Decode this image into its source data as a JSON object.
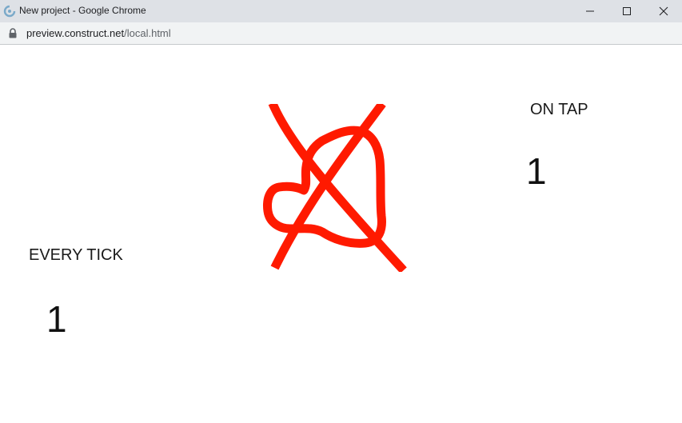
{
  "window": {
    "title": "New project - Google Chrome",
    "minimize_icon": "minimize-icon",
    "maximize_icon": "maximize-icon",
    "close_icon": "close-icon"
  },
  "address_bar": {
    "url_host": "preview.construct.net",
    "url_path": "/local.html",
    "lock_icon": "lock-icon"
  },
  "content": {
    "on_tap": {
      "label": "ON TAP",
      "value": "1"
    },
    "every_tick": {
      "label": "EVERY TICK",
      "value": "1"
    },
    "mute_icon": "muted-speaker-icon",
    "accent_color": "#ff1a00"
  }
}
